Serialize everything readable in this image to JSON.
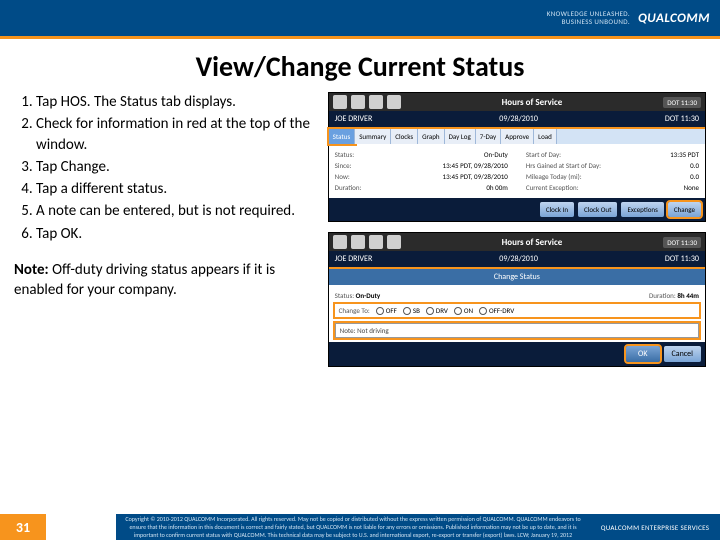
{
  "header": {
    "tagline_line1": "KNOWLEDGE UNLEASHED.",
    "tagline_line2": "BUSINESS UNBOUND.",
    "brand": "QUALCOMM"
  },
  "title": "View/Change Current Status",
  "steps": [
    "Tap HOS. The Status tab displays.",
    "Check for information in red at the top of the window.",
    "Tap Change.",
    "Tap a different status.",
    "A note can be entered, but is not required.",
    "Tap OK."
  ],
  "note_label": "Note:",
  "note_text": "Off-duty driving status appears if it is enabled for your company.",
  "shot1": {
    "window_title": "Hours of Service",
    "dot_badge": "DOT 11:30",
    "driver": "JOE DRIVER",
    "date": "09/28/2010",
    "tabs": [
      "Status",
      "Summary",
      "Clocks",
      "Graph",
      "Day Log",
      "7-Day",
      "Approve",
      "Load"
    ],
    "active_tab": "Status",
    "rows_left": [
      {
        "lbl": "Status:",
        "val": "On-Duty"
      },
      {
        "lbl": "Since:",
        "val": "13:45 PDT, 09/28/2010"
      },
      {
        "lbl": "Now:",
        "val": "13:45 PDT, 09/28/2010"
      },
      {
        "lbl": "Duration:",
        "val": "0h 00m"
      }
    ],
    "rows_right": [
      {
        "lbl": "Start of Day:",
        "val": "13:35 PDT"
      },
      {
        "lbl": "Hrs Gained at Start of Day:",
        "val": "0.0"
      },
      {
        "lbl": "Mileage Today (mi):",
        "val": "0.0"
      },
      {
        "lbl": "Current Exception:",
        "val": "None"
      }
    ],
    "bottom_buttons": [
      "Clock In",
      "Clock Out",
      "Exceptions",
      "Change"
    ],
    "highlight_button": "Change"
  },
  "shot2": {
    "window_title": "Hours of Service",
    "dot_badge": "DOT 11:30",
    "driver": "JOE DRIVER",
    "date": "09/28/2010",
    "panel_title": "Change Status",
    "status_lbl": "Status:",
    "status_val": "On-Duty",
    "duration_lbl": "Duration:",
    "duration_val": "8h 44m",
    "change_to_lbl": "Change To:",
    "options": [
      "OFF",
      "SB",
      "DRV",
      "ON",
      "OFF-DRV"
    ],
    "note_prefix": "Note:",
    "note_value": "Not driving",
    "ok_label": "OK",
    "cancel_label": "Cancel"
  },
  "footer": {
    "page": "31",
    "copyright": "Copyright © 2010-2012 QUALCOMM Incorporated. All rights reserved. May not be copied or distributed without the express written permission of QUALCOMM. QUALCOMM endeavors to ensure that the information in this document is correct and fairly stated, but QUALCOMM is not liable for any errors or omissions. Published information may not be up to date, and it is important to confirm current status with QUALCOMM. This technical data may be subject to U.S. and international export, re-export or transfer (export) laws. LCW; January 19, 2012",
    "service": "QUALCOMM ENTERPRISE SERVICES"
  }
}
